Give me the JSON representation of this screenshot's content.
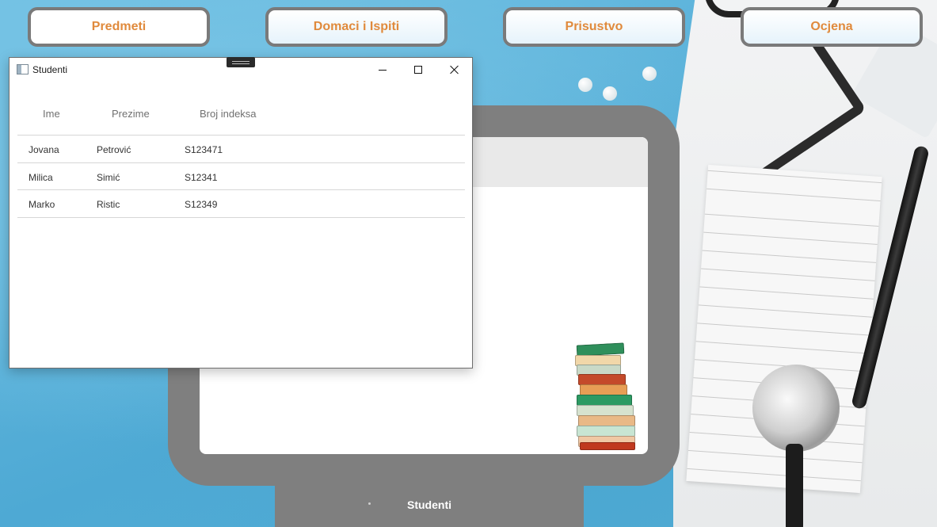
{
  "nav": {
    "buttons": [
      "Predmeti",
      "Domaci i Ispiti",
      "Prisustvo",
      "Ocjena"
    ]
  },
  "window": {
    "title": "Studenti",
    "columns": [
      "Ime",
      "Prezime",
      "Broj indeksa"
    ],
    "rows": [
      [
        "Jovana",
        "Petrović",
        "S123471"
      ],
      [
        "Milica",
        "Simić",
        "S12341"
      ],
      [
        "Marko",
        "Ristic",
        "S12349"
      ]
    ]
  },
  "stand": {
    "label": "Studenti"
  },
  "colors": {
    "accent": "#e08a3c",
    "frame": "#7f7f7f",
    "background": "#5bb3d9"
  },
  "icons": [
    "app-window-icon",
    "minimize-icon",
    "maximize-icon",
    "close-icon",
    "book-stack-icon"
  ]
}
